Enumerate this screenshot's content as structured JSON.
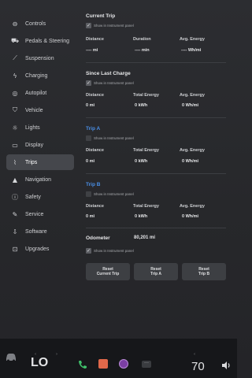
{
  "sidebar": {
    "items": [
      {
        "label": "Controls",
        "icon": "toggle-icon",
        "active": false
      },
      {
        "label": "Pedals & Steering",
        "icon": "car-icon",
        "active": false
      },
      {
        "label": "Suspension",
        "icon": "suspension-icon",
        "active": false
      },
      {
        "label": "Charging",
        "icon": "charging-bolt-icon",
        "active": false
      },
      {
        "label": "Autopilot",
        "icon": "steering-wheel-icon",
        "active": false
      },
      {
        "label": "Vehicle",
        "icon": "vehicle-icon",
        "active": false
      },
      {
        "label": "Lights",
        "icon": "sun-icon",
        "active": false
      },
      {
        "label": "Display",
        "icon": "display-icon",
        "active": false
      },
      {
        "label": "Trips",
        "icon": "trips-icon",
        "active": true
      },
      {
        "label": "Navigation",
        "icon": "navigation-arrow-icon",
        "active": false
      },
      {
        "label": "Safety",
        "icon": "safety-icon",
        "active": false
      },
      {
        "label": "Service",
        "icon": "wrench-icon",
        "active": false
      },
      {
        "label": "Software",
        "icon": "download-icon",
        "active": false
      },
      {
        "label": "Upgrades",
        "icon": "bag-icon",
        "active": false
      }
    ]
  },
  "current_trip": {
    "title": "Current Trip",
    "checkbox_label": "Show in Instrument panel",
    "checked": true,
    "labels": {
      "a": "Distance",
      "b": "Duration",
      "c": "Avg. Energy"
    },
    "values": {
      "a": "---- mi",
      "b": "---- min",
      "c": "---- Wh/mi"
    }
  },
  "since_last_charge": {
    "title": "Since Last Charge",
    "checkbox_label": "Show in Instrument panel",
    "checked": true,
    "labels": {
      "a": "Distance",
      "b": "Total Energy",
      "c": "Avg. Energy"
    },
    "values": {
      "a": "0 mi",
      "b": "0 kWh",
      "c": "0 Wh/mi"
    }
  },
  "trip_a": {
    "title": "Trip A",
    "checkbox_label": "Show in Instrument panel",
    "checked": false,
    "labels": {
      "a": "Distance",
      "b": "Total Energy",
      "c": "Avg. Energy"
    },
    "values": {
      "a": "0 mi",
      "b": "0 kWh",
      "c": "0 Wh/mi"
    }
  },
  "trip_b": {
    "title": "Trip B",
    "checkbox_label": "Show in Instrument panel",
    "checked": false,
    "labels": {
      "a": "Distance",
      "b": "Total Energy",
      "c": "Avg. Energy"
    },
    "values": {
      "a": "0 mi",
      "b": "0 kWh",
      "c": "0 Wh/mi"
    }
  },
  "odometer": {
    "label": "Odometer",
    "value": "80,201 mi",
    "checkbox_label": "Show in Instrument panel",
    "checked": true
  },
  "buttons": {
    "reset_current": {
      "line1": "Reset",
      "line2": "Current Trip"
    },
    "reset_a": {
      "line1": "Reset",
      "line2": "Trip A"
    },
    "reset_b": {
      "line1": "Reset",
      "line2": "Trip B"
    }
  },
  "taskbar": {
    "left_temp": "LO",
    "right_temp": "70",
    "icons": [
      "car-icon",
      "phone-icon",
      "music-app-icon",
      "camera-app-icon",
      "more-dots-icon",
      "volume-icon"
    ]
  },
  "colors": {
    "accent": "#4a8fe7",
    "active_nav": "#45474c"
  }
}
